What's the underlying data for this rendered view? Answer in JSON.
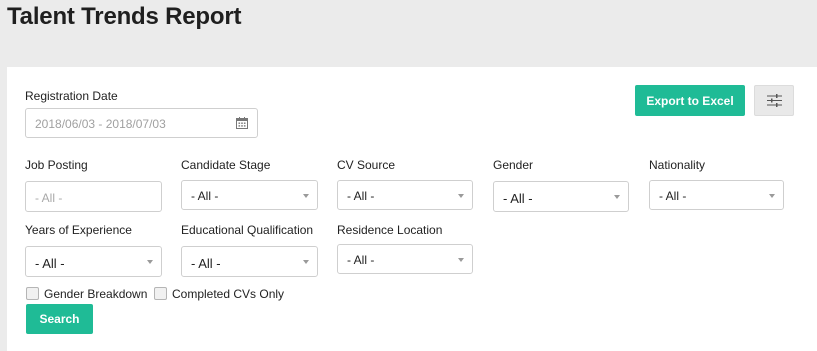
{
  "header": {
    "title": "Talent Trends Report"
  },
  "colors": {
    "accent": "#1fbb96",
    "page_bg": "#ebebeb",
    "panel_bg": "#ffffff"
  },
  "toolbar": {
    "export_label": "Export to Excel",
    "filter_settings_icon": "sliders-icon"
  },
  "filters": {
    "registration_date": {
      "label": "Registration Date",
      "value": "2018/06/03 - 2018/07/03",
      "icon": "calendar-icon"
    },
    "job_posting": {
      "label": "Job Posting",
      "placeholder": "- All -"
    },
    "candidate_stage": {
      "label": "Candidate Stage",
      "value": "- All -"
    },
    "cv_source": {
      "label": "CV Source",
      "value": "- All -"
    },
    "gender": {
      "label": "Gender",
      "value": "- All -"
    },
    "nationality": {
      "label": "Nationality",
      "value": "- All -"
    },
    "years_of_experience": {
      "label": "Years of Experience",
      "value": "- All -"
    },
    "educational_qualification": {
      "label": "Educational Qualification",
      "value": "- All -"
    },
    "residence_location": {
      "label": "Residence Location",
      "value": "- All -"
    }
  },
  "options": {
    "gender_breakdown": {
      "label": "Gender Breakdown",
      "checked": false
    },
    "completed_cvs_only": {
      "label": "Completed CVs Only",
      "checked": false
    }
  },
  "actions": {
    "search_label": "Search"
  }
}
